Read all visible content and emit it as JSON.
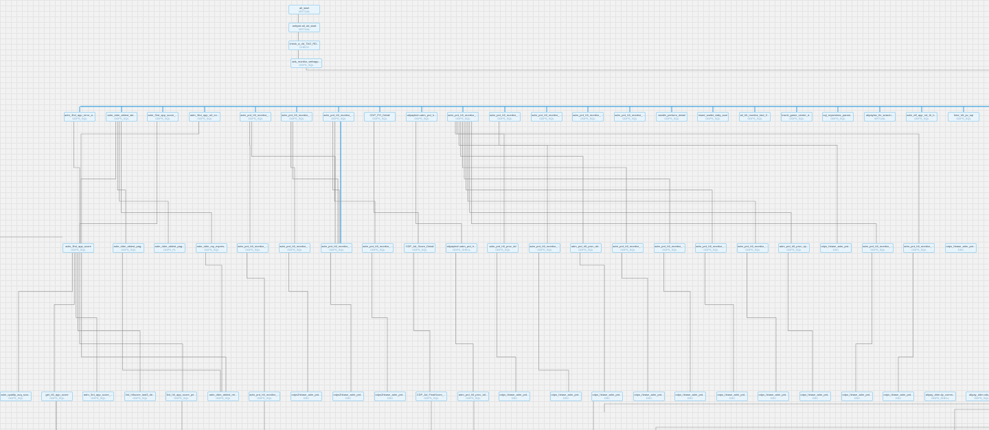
{
  "diagram": {
    "accent_color": "#3aa2e0",
    "edge_color": "#8c8c8c",
    "nodes": [
      {
        "id": "r1",
        "name": "all_start",
        "type": "VIRTUAL"
      },
      {
        "id": "r2",
        "name": "antiyde.ali_dd_start",
        "type": "VIRTUAL"
      },
      {
        "id": "r3",
        "name": "check_a_dd_TAG_RD...",
        "type": "CHECK"
      },
      {
        "id": "r4",
        "name": "ads_monitor_webapp...",
        "type": "ODPS_SQL"
      },
      {
        "id": "a1",
        "name": "adm_3hd_app_error_a...",
        "type": "ODPS_SQL"
      },
      {
        "id": "a2",
        "name": "adm_ddm_ablest_ski...",
        "type": "ODPS_SQL"
      },
      {
        "id": "a3",
        "name": "adm_3hd_app_score_...",
        "type": "ODPS_SQL"
      },
      {
        "id": "a4",
        "name": "adm_3hd_app_ret_ex...",
        "type": "ODPS_SQL"
      },
      {
        "id": "a5",
        "name": "adm_prd_h5_monitor_...",
        "type": "ODPS_SQL"
      },
      {
        "id": "a6",
        "name": "adm_prd_h5_monitor_...",
        "type": "ODPS_SQL"
      },
      {
        "id": "a7",
        "name": "adm_prd_h5_monitor_...",
        "type": "ODPS_SQL"
      },
      {
        "id": "a8",
        "name": "CDP_PO_Detail",
        "type": "ODPS_SQL"
      },
      {
        "id": "a9",
        "name": "alipaytech.adm_prd_h...",
        "type": "ODPS_SQL"
      },
      {
        "id": "a10",
        "name": "adm_prd_h5_monitor_...",
        "type": "ODPS_SQL"
      },
      {
        "id": "a11",
        "name": "adm_prd_h5_monitor_...",
        "type": "ODPS_SQL"
      },
      {
        "id": "a12",
        "name": "adm_prd_h5_monitor_...",
        "type": "ODPS_SQL"
      },
      {
        "id": "a13",
        "name": "adm_prd_h5_monitor_...",
        "type": "ODPS_SQL"
      },
      {
        "id": "a14",
        "name": "adm_prd_h5_monitor_...",
        "type": "ODPS_SQL"
      },
      {
        "id": "a15",
        "name": "wealth_perform_detail",
        "type": "ODPS_SQL"
      },
      {
        "id": "a16",
        "name": "insert_wallet_daily_sum",
        "type": "ODPS_SQL"
      },
      {
        "id": "a17",
        "name": "ali_h5_monitor_fact_0...",
        "type": "ODPS_SQL"
      },
      {
        "id": "a18",
        "name": "insert_game_center_d...",
        "type": "ODPS_SQL"
      },
      {
        "id": "a19",
        "name": "sql_mysesless_param...",
        "type": "ODPS_SQL"
      },
      {
        "id": "a20",
        "name": "alipayfac_fin_search...",
        "type": "VIRTUAL"
      },
      {
        "id": "a21",
        "name": "adm_eff_app_rot_th_h...",
        "type": "ODPS_SQL"
      },
      {
        "id": "a22",
        "name": "fuke_h5_pv_sql",
        "type": "ODPS_SQL"
      },
      {
        "id": "b1",
        "name": "adm_3hd_app_score",
        "type": "ODPS_SQL"
      },
      {
        "id": "b2",
        "name": "adm_ddm_ablest_pag...",
        "type": "ODPS_SQL"
      },
      {
        "id": "b3",
        "name": "adm_ddm_ablest_pag...",
        "type": "ODPS_PL"
      },
      {
        "id": "b4",
        "name": "adm_ddm_my_expres...",
        "type": "ODPS_SQL"
      },
      {
        "id": "b5",
        "name": "adm_prd_h5_monitor_...",
        "type": "ODPS_SQL"
      },
      {
        "id": "b6",
        "name": "adm_prd_h5_monitor_...",
        "type": "ODPS_SQL"
      },
      {
        "id": "b7",
        "name": "adm_prd_h5_monitor_...",
        "type": "ODPS_SQL"
      },
      {
        "id": "b8",
        "name": "adm_prd_h5_monitor_...",
        "type": "ODPS_SQL"
      },
      {
        "id": "b9",
        "name": "CDP_Ad_Score_Detail",
        "type": "ODPS_SQL"
      },
      {
        "id": "b10",
        "name": "alipaytech.adm_prd_h...",
        "type": "ODPS_SHELL"
      },
      {
        "id": "b11",
        "name": "adm_prd_h5_pruv_dd",
        "type": "ODPS_SQL"
      },
      {
        "id": "b12",
        "name": "adm_prd_h5_monitor_...",
        "type": "ODPS_SQL"
      },
      {
        "id": "b13",
        "name": "adm_prd_h5_pruv_dd...",
        "type": "ODPS_SQL"
      },
      {
        "id": "b14",
        "name": "adm_prd_h5_monitor_...",
        "type": "ODPS_SQL"
      },
      {
        "id": "b15",
        "name": "adm_prd_h5_monitor_...",
        "type": "ODPS_SQL"
      },
      {
        "id": "b16",
        "name": "adm_prd_h5_monitor_...",
        "type": "ODPS_SQL"
      },
      {
        "id": "b17",
        "name": "adm_prd_h5_monitor_...",
        "type": "ODPS_SQL"
      },
      {
        "id": "b18",
        "name": "adm_prd_h5_pruv_op...",
        "type": "ODPS_SQL"
      },
      {
        "id": "b19",
        "name": "odps_hbase_adm_prd...",
        "type": "DSC"
      },
      {
        "id": "b20",
        "name": "adm_prd_h5_monitor_...",
        "type": "ODPS_SQL"
      },
      {
        "id": "b21",
        "name": "adm_prd_h5_monitor_...",
        "type": "ODPS_SQL"
      },
      {
        "id": "b22",
        "name": "odps_hbase_adm_prd...",
        "type": "DSC"
      },
      {
        "id": "c1",
        "name": "adm_quality_acq_scor...",
        "type": "ODPS_SQL"
      },
      {
        "id": "c2",
        "name": "get_h5_app_score",
        "type": "ODPS_SQL"
      },
      {
        "id": "c3",
        "name": "adm_3rd_app_score_...",
        "type": "ODPS_SQL"
      },
      {
        "id": "c4",
        "name": "3rd_h5score_last3_de...",
        "type": "ODPS_SQL"
      },
      {
        "id": "c5",
        "name": "3rd_h5_app_score_pe...",
        "type": "ODPS_SQL"
      },
      {
        "id": "c6",
        "name": "adm_ddm_ablest_rei...",
        "type": "ODPS_SQL"
      },
      {
        "id": "c7",
        "name": "adm_prd_h5_monitor_...",
        "type": "ODPS_SQL"
      },
      {
        "id": "c8",
        "name": "odps2hbase_adm_prd...",
        "type": "DSC"
      },
      {
        "id": "c9",
        "name": "odps2hbase_adm_prd...",
        "type": "DSC"
      },
      {
        "id": "c10",
        "name": "odps2hbase_adm_prd...",
        "type": "DSC"
      },
      {
        "id": "c11",
        "name": "CDP_Ad_FinalScore_...",
        "type": "ODPS_SQL"
      },
      {
        "id": "c12",
        "name": "adm_prd_h5_pruv_dd...",
        "type": "ODPS_SQL"
      },
      {
        "id": "c13",
        "name": "odps_hbase_adm_prd...",
        "type": "DSC"
      },
      {
        "id": "c14",
        "name": "odps_hbase_adm_prd...",
        "type": "DSC"
      },
      {
        "id": "c15",
        "name": "odps_hbase_adm_prd...",
        "type": "DSC"
      },
      {
        "id": "c16",
        "name": "odps_hbase_adm_prd...",
        "type": "DSC"
      },
      {
        "id": "c17",
        "name": "odps_hbase_adm_prd...",
        "type": "DSC"
      },
      {
        "id": "c18",
        "name": "odps_hbase_adm_prd...",
        "type": "DSC"
      },
      {
        "id": "c19",
        "name": "odps_hbase_adm_prd...",
        "type": "DSC"
      },
      {
        "id": "c20",
        "name": "odps_hbase_adm_prd...",
        "type": "DSC"
      },
      {
        "id": "c21",
        "name": "odps_hbase_adm_prd...",
        "type": "DSC"
      },
      {
        "id": "c22",
        "name": "odps_hbase_adm_prd...",
        "type": "DSC"
      },
      {
        "id": "c23",
        "name": "alipay_ddm.dp_comm...",
        "type": "ODPS_SHELL"
      },
      {
        "id": "c24",
        "name": "alipay_ddm.ods_h...",
        "type": "ODPS_SQL"
      }
    ],
    "edges": [
      [
        "r1",
        "r2"
      ],
      [
        "r2",
        "r3"
      ],
      [
        "r3",
        "r4"
      ],
      [
        "a1",
        "b1"
      ],
      [
        "a2",
        "b1"
      ],
      [
        "a2",
        "b2"
      ],
      [
        "a2",
        "b3"
      ],
      [
        "a2",
        "b4"
      ],
      [
        "a3",
        "b1"
      ],
      [
        "a4",
        "b1"
      ],
      [
        "a5",
        "b5"
      ],
      [
        "a5",
        "b7"
      ],
      [
        "a6",
        "b6"
      ],
      [
        "a6",
        "b7"
      ],
      [
        "a7",
        "b7"
      ],
      [
        "a7",
        "b8"
      ],
      [
        "a8",
        "b9"
      ],
      [
        "a9",
        "b10"
      ],
      [
        "a10",
        "b11"
      ],
      [
        "a10",
        "b12"
      ],
      [
        "a10",
        "b13"
      ],
      [
        "a10",
        "b14"
      ],
      [
        "a10",
        "b15"
      ],
      [
        "a10",
        "b16"
      ],
      [
        "a10",
        "b17"
      ],
      [
        "a10",
        "b18"
      ],
      [
        "a10",
        "b20"
      ],
      [
        "a10",
        "b21"
      ],
      [
        "a11",
        "b19"
      ],
      [
        "b1",
        "c1"
      ],
      [
        "b1",
        "c2"
      ],
      [
        "b1",
        "c3"
      ],
      [
        "b1",
        "c4"
      ],
      [
        "b1",
        "c5"
      ],
      [
        "b1",
        "c6"
      ],
      [
        "b2",
        "c6"
      ],
      [
        "b4",
        "c6"
      ],
      [
        "b5",
        "c7"
      ],
      [
        "b6",
        "c8"
      ],
      [
        "b7",
        "c9"
      ],
      [
        "b8",
        "c10"
      ],
      [
        "b9",
        "c11"
      ],
      [
        "b10",
        "c12"
      ],
      [
        "b11",
        "c13"
      ],
      [
        "b12",
        "c14"
      ],
      [
        "b13",
        "c15"
      ],
      [
        "b14",
        "c16"
      ],
      [
        "b15",
        "c17"
      ],
      [
        "b16",
        "c18"
      ],
      [
        "b17",
        "c19"
      ],
      [
        "b18",
        "c20"
      ],
      [
        "b20",
        "c21"
      ],
      [
        "b21",
        "c22"
      ]
    ]
  }
}
